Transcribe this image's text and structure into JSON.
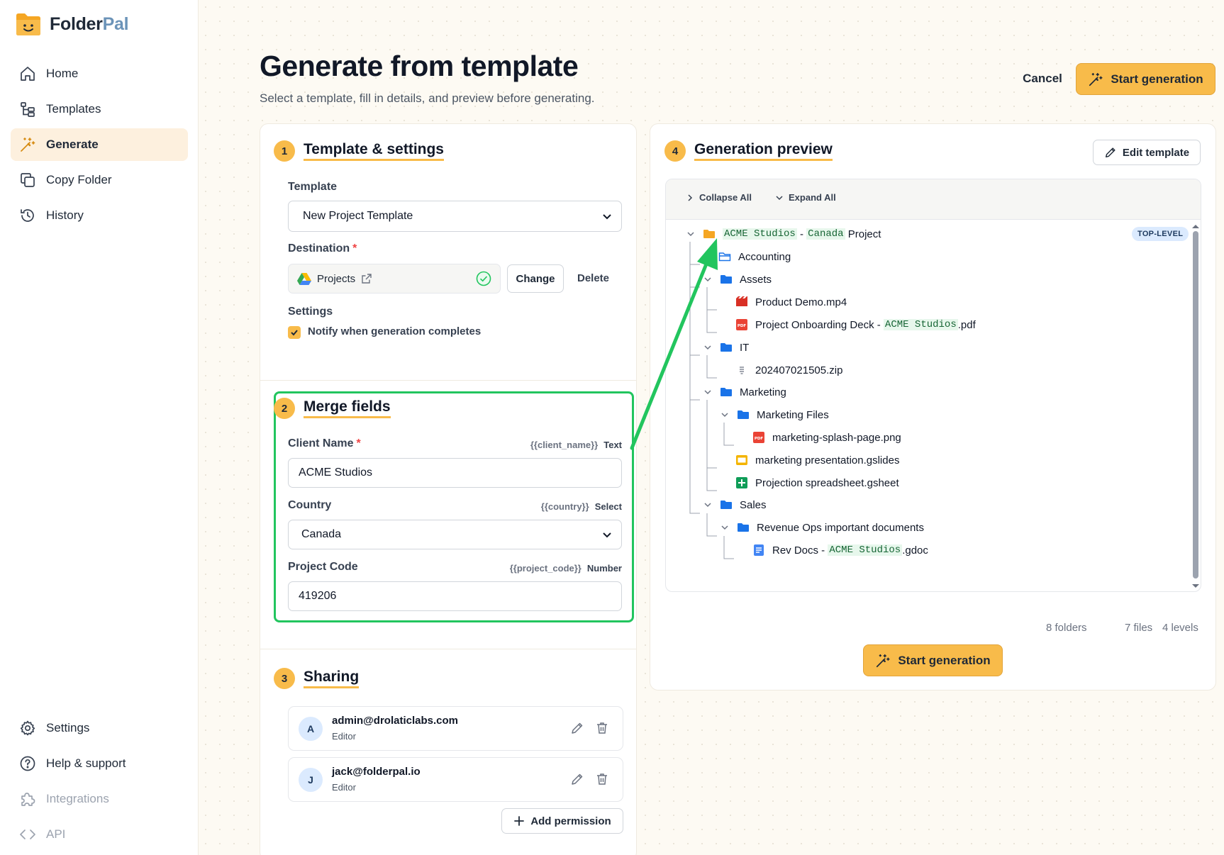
{
  "app": {
    "name_main": "Folder",
    "name_accent": "Pal"
  },
  "nav": {
    "home": "Home",
    "templates": "Templates",
    "generate": "Generate",
    "copy_folder": "Copy Folder",
    "history": "History",
    "settings": "Settings",
    "help": "Help & support",
    "integrations": "Integrations",
    "api": "API"
  },
  "header": {
    "title": "Generate from template",
    "subtitle": "Select a template, fill in details, and preview before generating.",
    "cancel": "Cancel",
    "start": "Start generation"
  },
  "section1": {
    "step": "1",
    "title": "Template & settings",
    "template_label": "Template",
    "template_value": "New Project Template",
    "destination_label": "Destination",
    "destination_value": "Projects",
    "change": "Change",
    "delete": "Delete",
    "settings_label": "Settings",
    "notify_label": "Notify when generation completes",
    "notify_checked": true
  },
  "section2": {
    "step": "2",
    "title": "Merge fields",
    "fields": [
      {
        "label": "Client Name",
        "required": true,
        "token": "{{client_name}}",
        "type": "Text",
        "value": "ACME Studios"
      },
      {
        "label": "Country",
        "required": false,
        "token": "{{country}}",
        "type": "Select",
        "value": "Canada"
      },
      {
        "label": "Project Code",
        "required": false,
        "token": "{{project_code}}",
        "type": "Number",
        "value": "419206"
      }
    ]
  },
  "section3": {
    "step": "3",
    "title": "Sharing",
    "permissions": [
      {
        "initial": "A",
        "email": "admin@drolaticlabs.com",
        "role": "Editor"
      },
      {
        "initial": "J",
        "email": "jack@folderpal.io",
        "role": "Editor"
      }
    ],
    "add_permission": "Add permission"
  },
  "section4": {
    "step": "4",
    "title": "Generation preview",
    "edit_template": "Edit template",
    "collapse_all": "Collapse All",
    "expand_all": "Expand All",
    "top_level_badge": "TOP-LEVEL",
    "root": {
      "client": "ACME Studios",
      "sep": " - ",
      "country": "Canada",
      "suffix": " Project"
    },
    "tree": {
      "accounting": "Accounting",
      "assets": "Assets",
      "product_demo": "Product Demo.mp4",
      "deck_prefix": "Project Onboarding Deck - ",
      "deck_client": "ACME Studios",
      "deck_suffix": ".pdf",
      "it": "IT",
      "zip": "202407021505.zip",
      "marketing": "Marketing",
      "marketing_files": "Marketing Files",
      "splash": "marketing-splash-page.png",
      "presentation": "marketing presentation.gslides",
      "spreadsheet": "Projection spreadsheet.gsheet",
      "sales": "Sales",
      "revops": "Revenue Ops important documents",
      "revdocs_prefix": "Rev Docs - ",
      "revdocs_client": "ACME Studios",
      "revdocs_suffix": ".gdoc"
    },
    "stats": {
      "folders": "8 folders",
      "files": "7 files",
      "levels": "4 levels"
    },
    "start": "Start generation"
  },
  "colors": {
    "accent": "#f8bb4a",
    "highlight": "#22c55e",
    "folder_blue": "#1a73e8",
    "folder_orange": "#f5a623"
  },
  "icons": [
    "home-icon",
    "templates-icon",
    "wand-icon",
    "copy-icon",
    "history-icon",
    "gear-icon",
    "help-icon",
    "puzzle-icon",
    "code-icon",
    "drive-icon",
    "external-link-icon",
    "check-circle-icon",
    "pencil-icon",
    "trash-icon",
    "plus-icon",
    "folder-icon",
    "video-icon",
    "pdf-icon",
    "zip-icon",
    "slides-icon",
    "sheets-icon",
    "doc-icon"
  ]
}
